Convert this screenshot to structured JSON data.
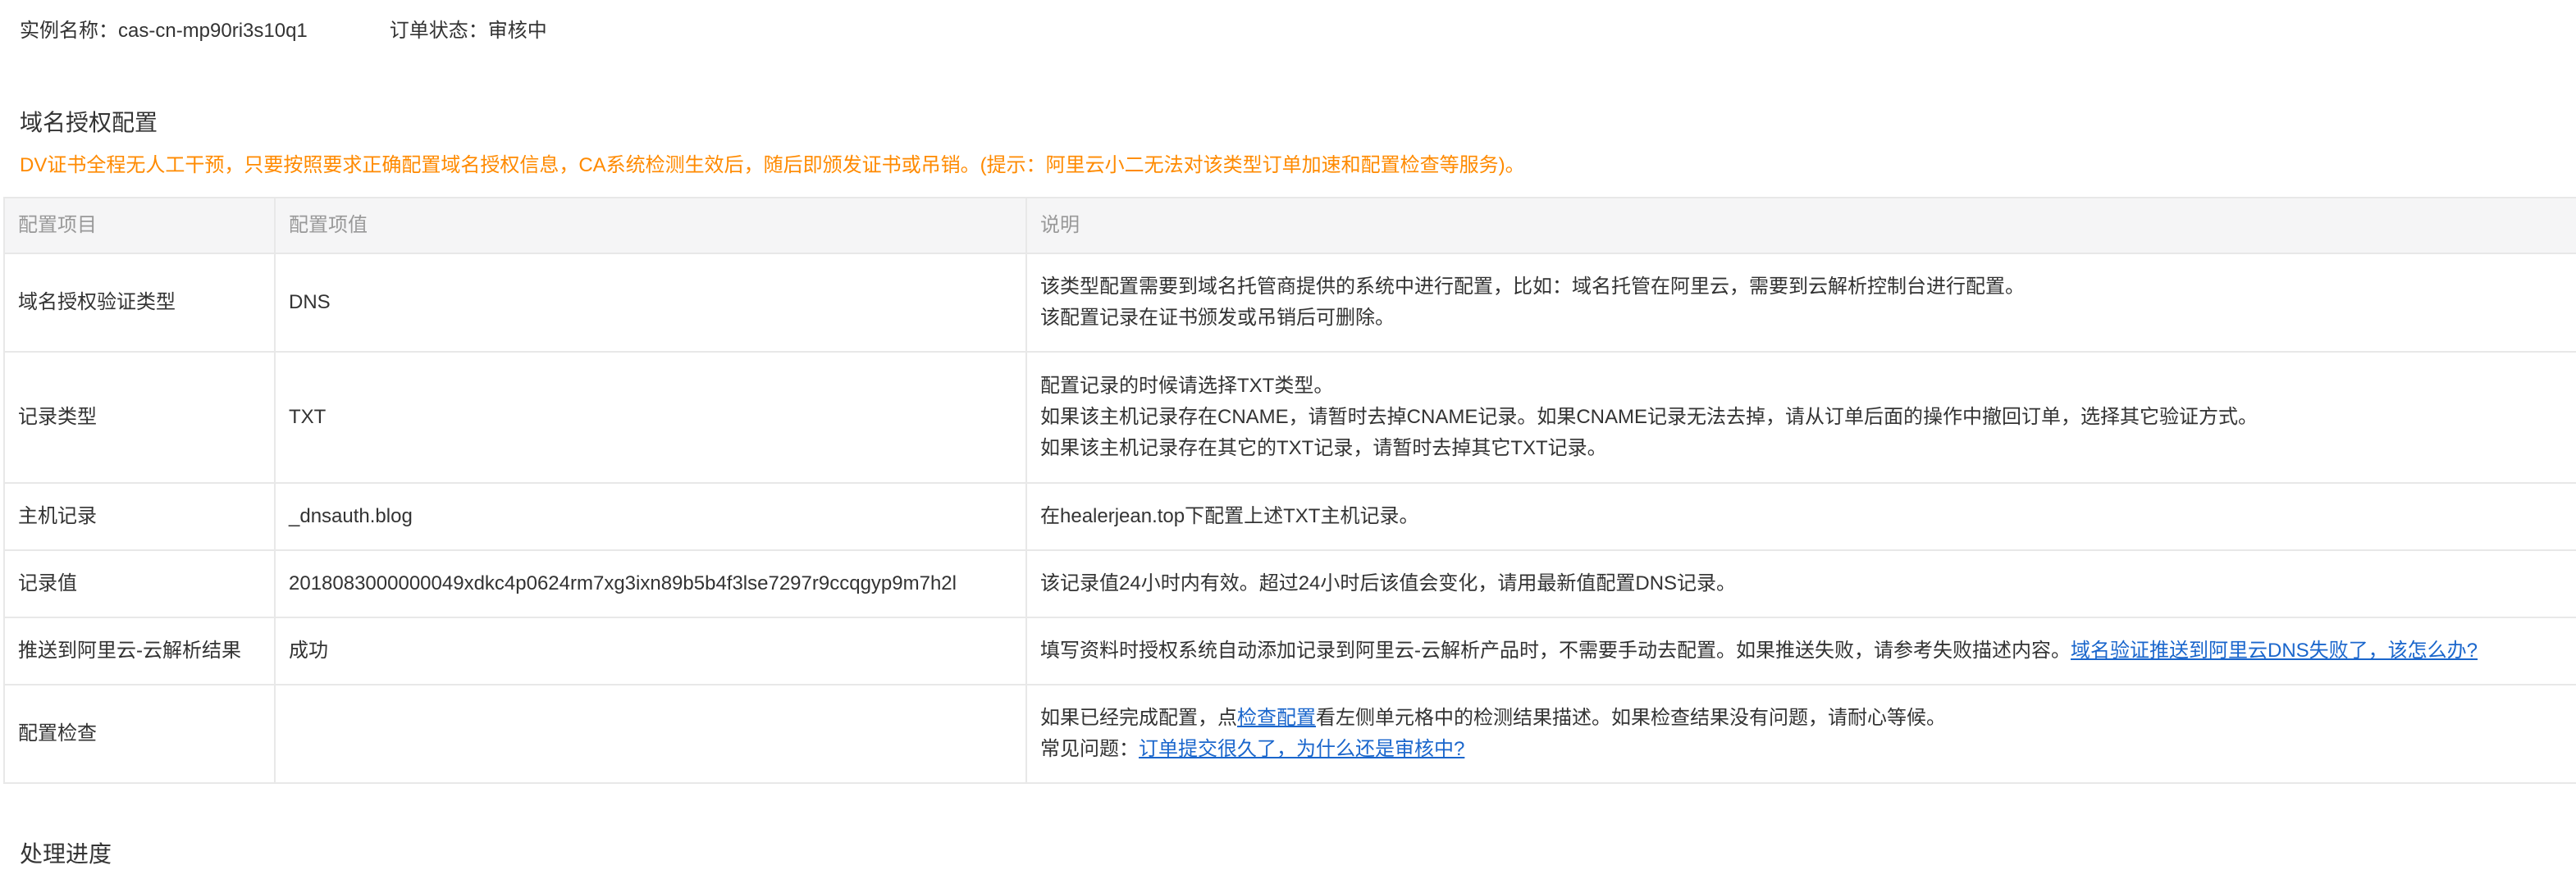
{
  "instance": {
    "name_label": "实例名称：",
    "name_value": "cas-cn-mp90ri3s10q1",
    "status_label": "订单状态：",
    "status_value": "审核中"
  },
  "domain_auth": {
    "title": "域名授权配置",
    "hint": "DV证书全程无人工干预，只要按照要求正确配置域名授权信息，CA系统检测生效后，随后即颁发证书或吊销。(提示：阿里云小二无法对该类型订单加速和配置检查等服务)。"
  },
  "table": {
    "headers": [
      "配置项目",
      "配置项值",
      "说明"
    ],
    "rows": [
      {
        "item": "域名授权验证类型",
        "value": "DNS",
        "desc": [
          "该类型配置需要到域名托管商提供的系统中进行配置，比如：域名托管在阿里云，需要到云解析控制台进行配置。",
          "该配置记录在证书颁发或吊销后可删除。"
        ]
      },
      {
        "item": "记录类型",
        "value": "TXT",
        "desc": [
          "配置记录的时候请选择TXT类型。",
          "如果该主机记录存在CNAME，请暂时去掉CNAME记录。如果CNAME记录无法去掉，请从订单后面的操作中撤回订单，选择其它验证方式。",
          "如果该主机记录存在其它的TXT记录，请暂时去掉其它TXT记录。"
        ]
      },
      {
        "item": "主机记录",
        "value": "_dnsauth.blog",
        "desc": [
          "在healerjean.top下配置上述TXT主机记录。"
        ]
      },
      {
        "item": "记录值",
        "value": "2018083000000049xdkc4p0624rm7xg3ixn89b5b4f3lse7297r9ccqgyp9m7h2l",
        "desc": [
          "该记录值24小时内有效。超过24小时后该值会变化，请用最新值配置DNS记录。"
        ]
      },
      {
        "item": "推送到阿里云-云解析结果",
        "value": "成功",
        "desc_text": "填写资料时授权系统自动添加记录到阿里云-云解析产品时，不需要手动去配置。如果推送失败，请参考失败描述内容。",
        "desc_link": "域名验证推送到阿里云DNS失败了，该怎么办?"
      },
      {
        "item": "配置检查",
        "value": "",
        "desc_line1_pre": "如果已经完成配置，点",
        "desc_line1_link": "检查配置",
        "desc_line1_post": "看左侧单元格中的检测结果描述。如果检查结果没有问题，请耐心等候。",
        "desc_line2_pre": "常见问题：",
        "desc_line2_link": "订单提交很久了，为什么还是审核中?"
      }
    ]
  },
  "progress": {
    "title": "处理进度"
  },
  "colors": {
    "hint": "#ff8a00",
    "success": "#1e9e1e",
    "link": "#1a66cc",
    "header_bg": "#f5f5f6",
    "border": "#e8e8e8"
  }
}
